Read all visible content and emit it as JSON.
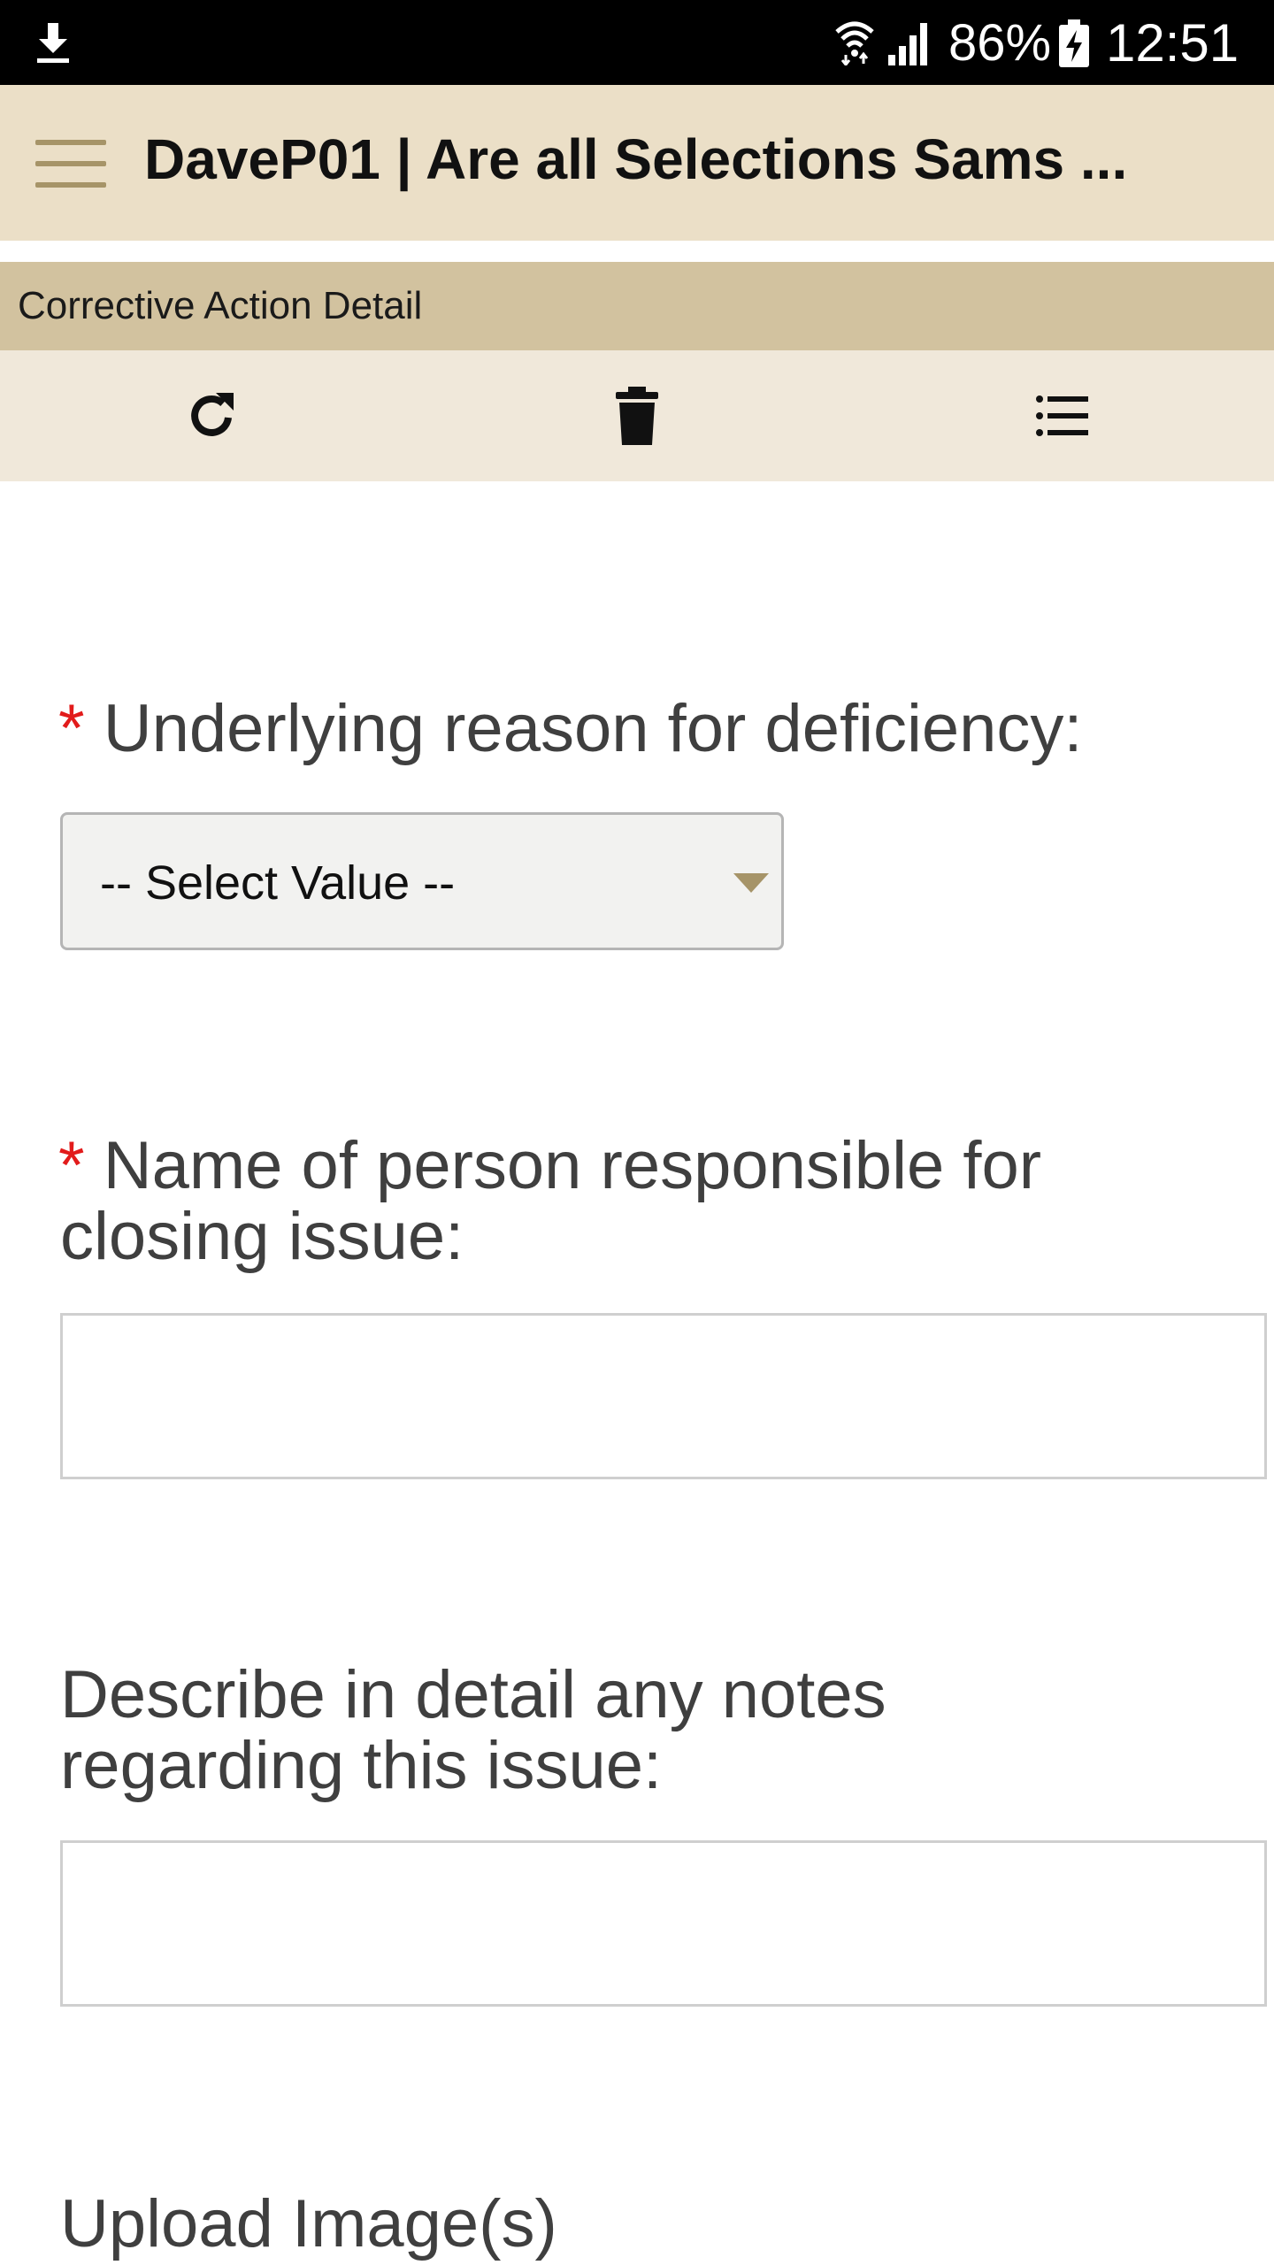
{
  "status_bar": {
    "battery_percent": "86%",
    "time": "12:51"
  },
  "header": {
    "title": "DaveP01 | Are all Selections Sams ..."
  },
  "section": {
    "title": "Corrective Action Detail"
  },
  "toolbar": {
    "buttons": [
      "refresh-icon",
      "trash-icon",
      "list-icon"
    ]
  },
  "form": {
    "required_marker": "*",
    "reason": {
      "label": "Underlying reason for deficiency:",
      "selected": "-- Select Value --"
    },
    "responsible": {
      "label_line1": "Name of person responsible for",
      "label_line2": "closing issue:",
      "value": ""
    },
    "notes": {
      "label_line1": "Describe in detail any notes",
      "label_line2": "regarding this issue:",
      "value": ""
    },
    "upload": {
      "label": "Upload Image(s)"
    }
  },
  "colors": {
    "header_bg": "#ebdfc7",
    "section_bg": "#d2c29f",
    "toolbar_bg": "#f0e8da",
    "accent": "#a69468",
    "required": "#e21b1b"
  }
}
